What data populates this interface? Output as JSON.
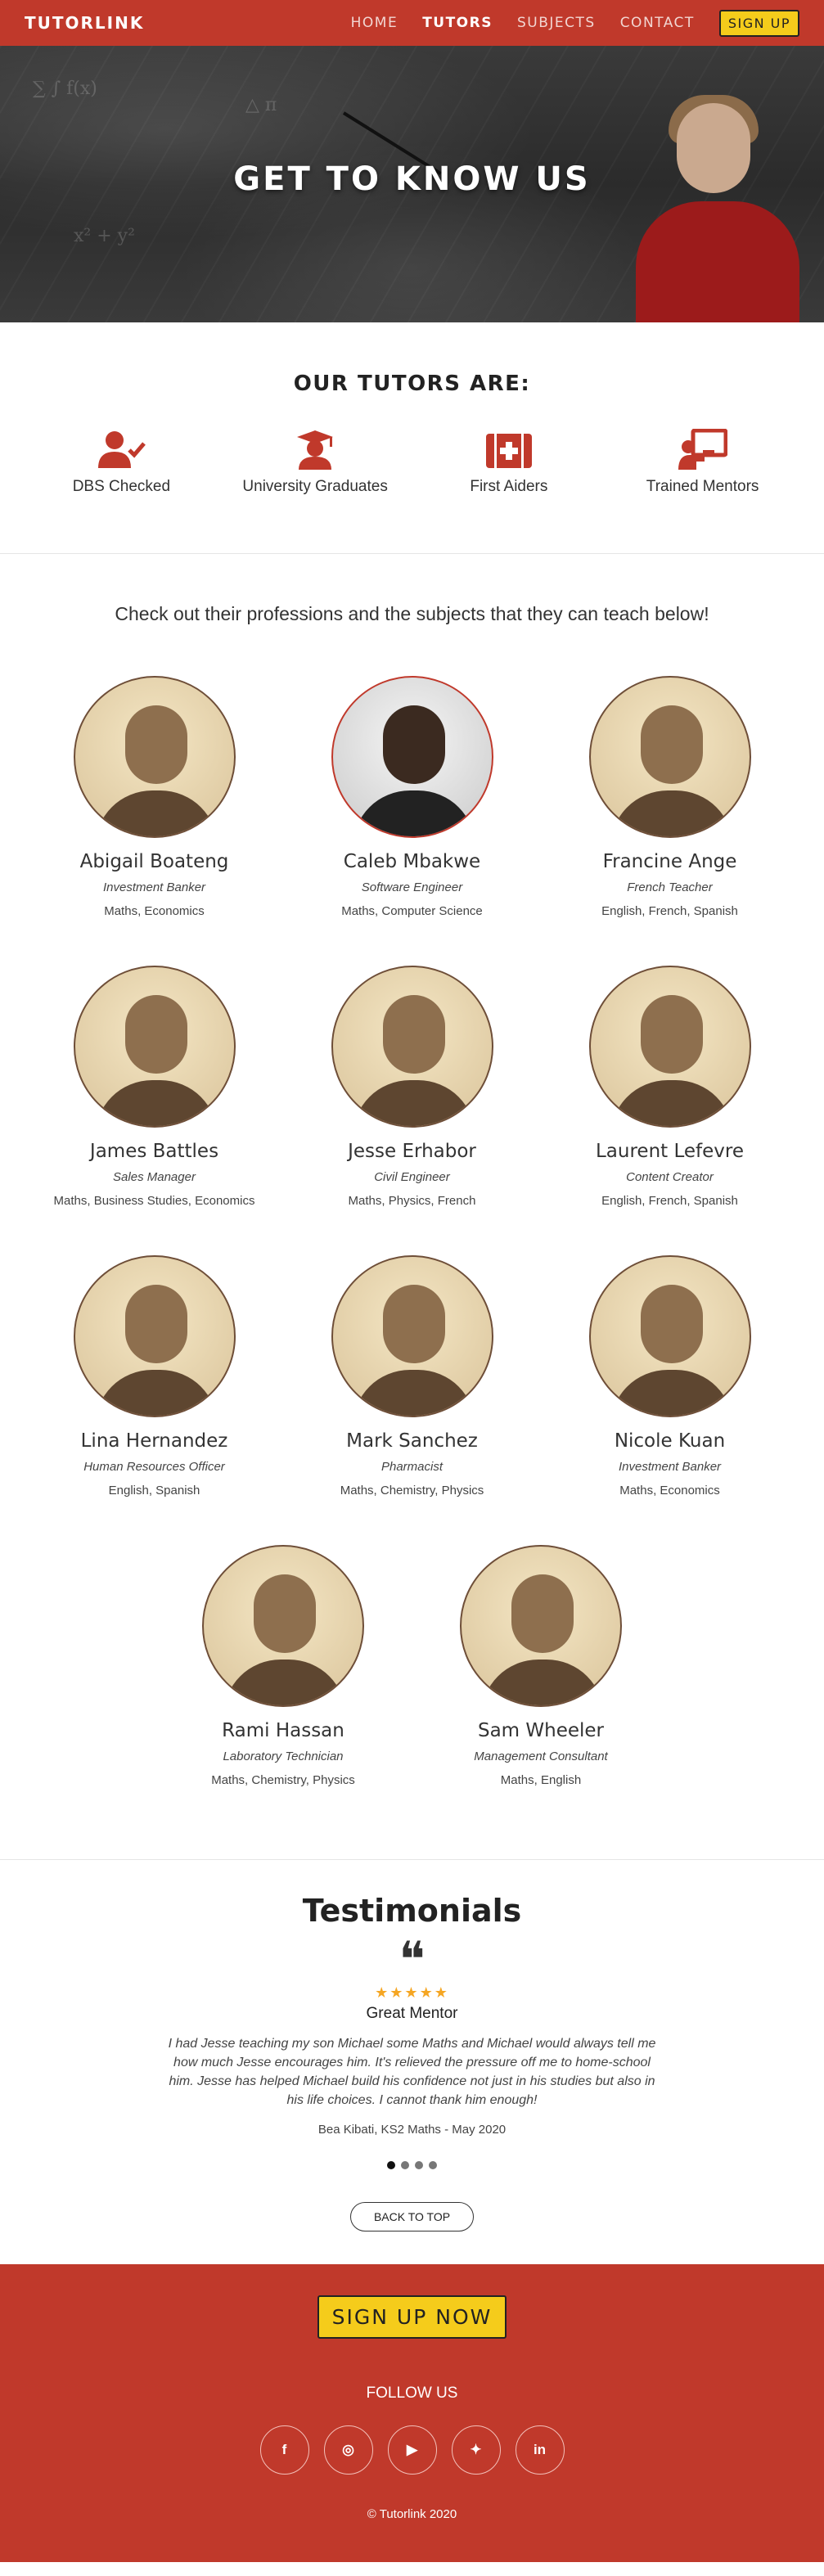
{
  "nav": {
    "brand": "TUTORLINK",
    "links": [
      "HOME",
      "TUTORS",
      "SUBJECTS",
      "CONTACT"
    ],
    "active": "TUTORS",
    "signup": "SIGN UP"
  },
  "hero": {
    "title": "GET TO KNOW US"
  },
  "features": {
    "title": "OUR TUTORS ARE:",
    "items": [
      {
        "label": "DBS Checked",
        "icon": "user-check-icon"
      },
      {
        "label": "University Graduates",
        "icon": "graduation-cap-icon"
      },
      {
        "label": "First Aiders",
        "icon": "first-aid-icon"
      },
      {
        "label": "Trained Mentors",
        "icon": "chalkboard-teacher-icon"
      }
    ]
  },
  "tutors": {
    "intro": "Check out their professions and the subjects that they can teach below!",
    "list": [
      {
        "name": "Abigail Boateng",
        "job": "Investment Banker",
        "subjects": "Maths, Economics"
      },
      {
        "name": "Caleb Mbakwe",
        "job": "Software Engineer",
        "subjects": "Maths, Computer Science"
      },
      {
        "name": "Francine Ange",
        "job": "French Teacher",
        "subjects": "English, French, Spanish"
      },
      {
        "name": "James Battles",
        "job": "Sales Manager",
        "subjects": "Maths, Business Studies, Economics"
      },
      {
        "name": "Jesse Erhabor",
        "job": "Civil Engineer",
        "subjects": "Maths, Physics, French"
      },
      {
        "name": "Laurent Lefevre",
        "job": "Content Creator",
        "subjects": "English, French, Spanish"
      },
      {
        "name": "Lina Hernandez",
        "job": "Human Resources Officer",
        "subjects": "English, Spanish"
      },
      {
        "name": "Mark Sanchez",
        "job": "Pharmacist",
        "subjects": "Maths, Chemistry, Physics"
      },
      {
        "name": "Nicole Kuan",
        "job": "Investment Banker",
        "subjects": "Maths, Economics"
      },
      {
        "name": "Rami Hassan",
        "job": "Laboratory Technician",
        "subjects": "Maths, Chemistry, Physics"
      },
      {
        "name": "Sam Wheeler",
        "job": "Management Consultant",
        "subjects": "Maths, English"
      }
    ]
  },
  "testimonials": {
    "title": "Testimonials",
    "quote_mark": "❝",
    "stars": "★★★★★",
    "heading": "Great Mentor",
    "text": "I had Jesse teaching my son Michael some Maths and Michael would always tell me how much Jesse encourages him. It's relieved the pressure off me to home-school him. Jesse has helped Michael build his confidence not just in his studies but also in his life choices. I cannot thank him enough!",
    "author": "Bea Kibati, KS2 Maths - May 2020",
    "slides": 4,
    "active_slide": 0
  },
  "back_to_top": "BACK TO TOP",
  "footer": {
    "signup": "SIGN UP NOW",
    "follow": "FOLLOW US",
    "socials": [
      {
        "name": "facebook-icon",
        "glyph": "f"
      },
      {
        "name": "instagram-icon",
        "glyph": "◎"
      },
      {
        "name": "youtube-icon",
        "glyph": "▶"
      },
      {
        "name": "twitter-icon",
        "glyph": "✦"
      },
      {
        "name": "linkedin-icon",
        "glyph": "in"
      }
    ],
    "copyright": "© Tutorlink 2020"
  },
  "colors": {
    "brand": "#c0392b",
    "accent": "#f5cc1b",
    "stars": "#f5a623"
  }
}
